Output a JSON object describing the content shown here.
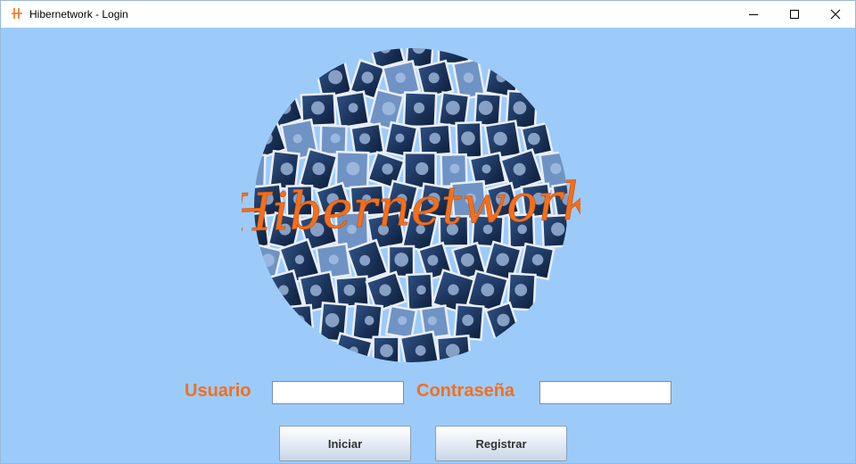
{
  "window": {
    "title": "Hibernetwork - Login"
  },
  "brand": {
    "logo_text": "Hibernetwork",
    "accent_color": "#f36f1c",
    "background_color": "#9ccbfa"
  },
  "form": {
    "username_label": "Usuario",
    "username_value": "",
    "password_label": "Contraseña",
    "password_value": ""
  },
  "buttons": {
    "login_label": "Iniciar",
    "register_label": "Registrar"
  },
  "icons": [
    "app-icon",
    "minimize-icon",
    "maximize-icon",
    "close-icon"
  ]
}
